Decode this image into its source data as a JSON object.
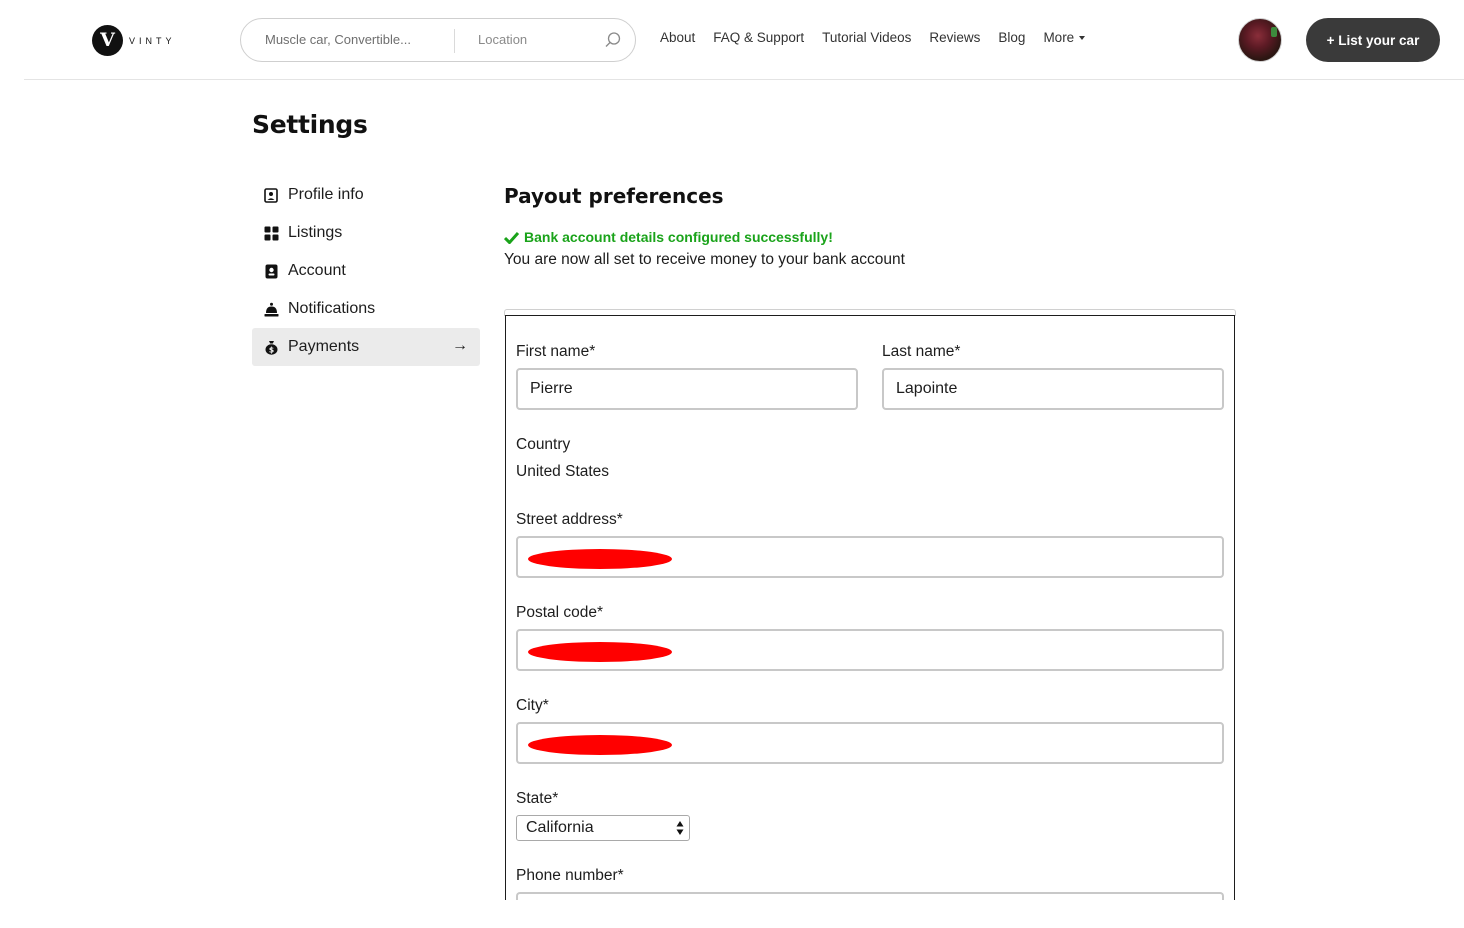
{
  "header": {
    "logo_letter": "V",
    "logo_text": "VINTY",
    "search": {
      "query_placeholder": "Muscle car, Convertible...",
      "location_placeholder": "Location"
    },
    "nav": [
      "About",
      "FAQ & Support",
      "Tutorial Videos",
      "Reviews",
      "Blog"
    ],
    "more_label": "More",
    "list_car_label": "+ List your car"
  },
  "settings": {
    "title": "Settings",
    "sidebar": [
      {
        "label": "Profile info",
        "icon": "profile-icon"
      },
      {
        "label": "Listings",
        "icon": "grid-icon"
      },
      {
        "label": "Account",
        "icon": "account-icon"
      },
      {
        "label": "Notifications",
        "icon": "bell-icon"
      },
      {
        "label": "Payments",
        "icon": "money-bag-icon",
        "active": true
      }
    ],
    "active_arrow": "→"
  },
  "payout": {
    "title": "Payout preferences",
    "success_message": "Bank account details configured successfully!",
    "success_sub": "You are now all set to receive money to your bank account",
    "success_color": "#1aa31a",
    "form": {
      "first_name_label": "First name*",
      "first_name_value": "Pierre",
      "last_name_label": "Last name*",
      "last_name_value": "Lapointe",
      "country_label": "Country",
      "country_value": "United States",
      "street_label": "Street address*",
      "postal_label": "Postal code*",
      "city_label": "City*",
      "state_label": "State*",
      "state_value": "California",
      "phone_label": "Phone number*"
    }
  }
}
